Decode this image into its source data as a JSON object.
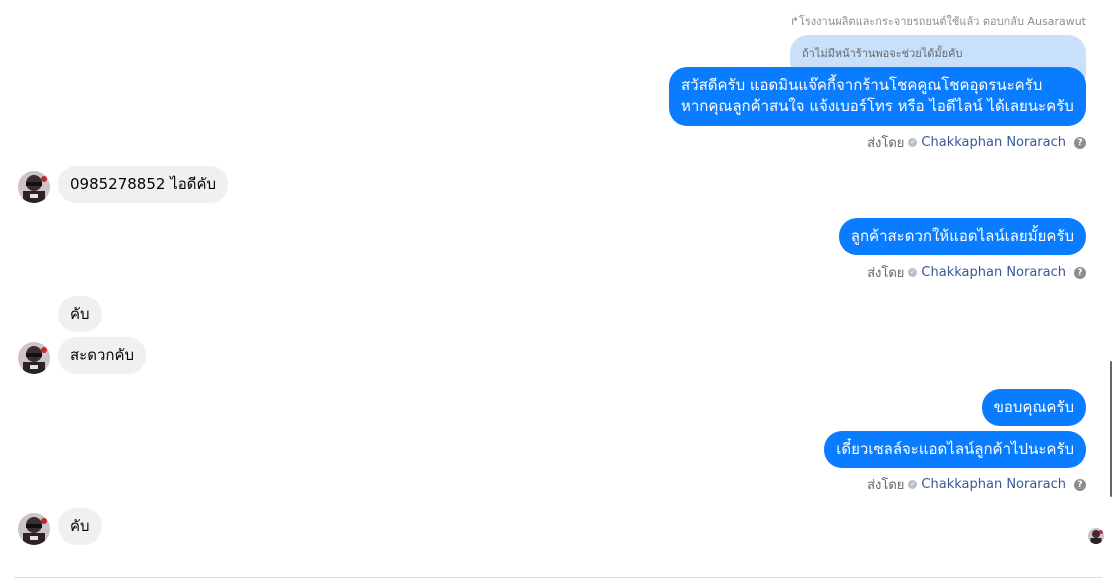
{
  "reply": {
    "context": "↱โรงงานผลิตและกระจายรถยนต์ใช้แล้ว ตอบกลับ Ausarawut",
    "quoted": "ถ้าไม่มีหน้าร้านพอจะช่วยได้มั้ยคับ"
  },
  "messages": {
    "out1_line1": "สวัสดีครับ แอดมินแจ๊คกี้จากร้านโชคคูณโชคอุดรนะครับ",
    "out1_line2": "หากคุณลูกค้าสนใจ แจ้งเบอร์โทร หรือ ไอดีไลน์ ได้เลยนะครับ",
    "in1": "0985278852 ไอดีคับ",
    "out2": "ลูกค้าสะดวกให้แอดไลน์เลยมั้ยครับ",
    "in2": "คับ",
    "in3": "สะดวกคับ",
    "out3": "ขอบคุณครับ",
    "out4": "เดี๋ยวเซลล์จะแอดไลน์ลูกค้าไปนะครับ",
    "in4": "คับ"
  },
  "sent_by": {
    "label": "ส่งโดย",
    "name": "Chakkaphan Norarach",
    "help": "?",
    "check": "✓"
  },
  "colors": {
    "outgoing_bubble": "#0a7cff",
    "incoming_bubble": "#f0f0f0",
    "reply_bubble": "#c9e0fb",
    "sender_name": "#385898"
  },
  "icons": {
    "help": "help-icon",
    "verified": "check-icon",
    "avatar": "contact-avatar"
  }
}
